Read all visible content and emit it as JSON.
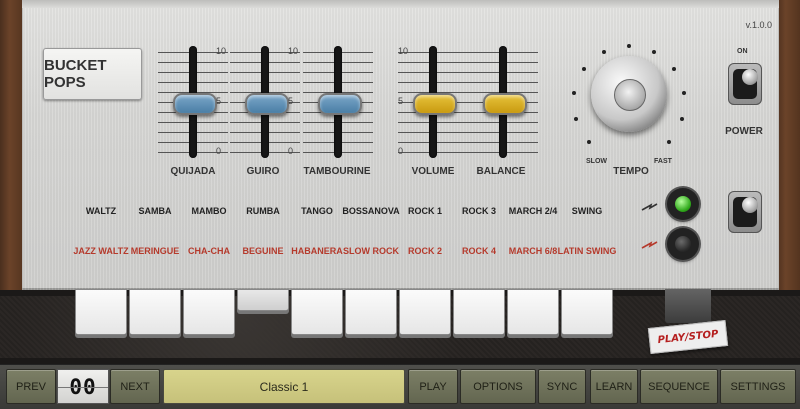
{
  "app": {
    "version": "v.1.0.0",
    "brand": "BUCKET POPS"
  },
  "sliders": [
    {
      "id": "quijada",
      "label": "QUIJADA",
      "level": 5,
      "color": "blue"
    },
    {
      "id": "guiro",
      "label": "GUIRO",
      "level": 5,
      "color": "blue"
    },
    {
      "id": "tambourine",
      "label": "TAMBOURINE",
      "level": 5,
      "color": "blue"
    },
    {
      "id": "volume",
      "label": "VOLUME",
      "level": 5,
      "color": "yellow"
    },
    {
      "id": "balance",
      "label": "BALANCE",
      "level": 5,
      "color": "yellow"
    }
  ],
  "scale": {
    "max": "10",
    "mid": "5",
    "min": "0"
  },
  "tempo": {
    "label": "TEMPO",
    "slow": "SLOW",
    "fast": "FAST"
  },
  "power": {
    "on": "ON",
    "label": "POWER"
  },
  "rhythms_top": [
    "WALTZ",
    "SAMBA",
    "MAMBO",
    "RUMBA",
    "TANGO",
    "BOSSANOVA",
    "ROCK 1",
    "ROCK 3",
    "MARCH 2/4",
    "SWING"
  ],
  "rhythms_bottom": [
    "JAZZ WALTZ",
    "MERINGUE",
    "CHA-CHA",
    "BEGUINE",
    "HABANERA",
    "SLOW ROCK",
    "ROCK 2",
    "ROCK 4",
    "MARCH 6/8",
    "LATIN SWING"
  ],
  "keys_down": [
    3
  ],
  "playstop": "PLAY/STOP",
  "toolbar": {
    "prev": "PREV",
    "counter": "00",
    "next": "NEXT",
    "preset": "Classic 1",
    "play": "PLAY",
    "options": "OPTIONS",
    "sync": "SYNC",
    "learn": "LEARN",
    "sequence": "SEQUENCE",
    "settings": "SETTINGS"
  },
  "colors": {
    "accent_red": "#b53a2c",
    "display": "#d3cf86",
    "led_green": "#2fa81a"
  }
}
